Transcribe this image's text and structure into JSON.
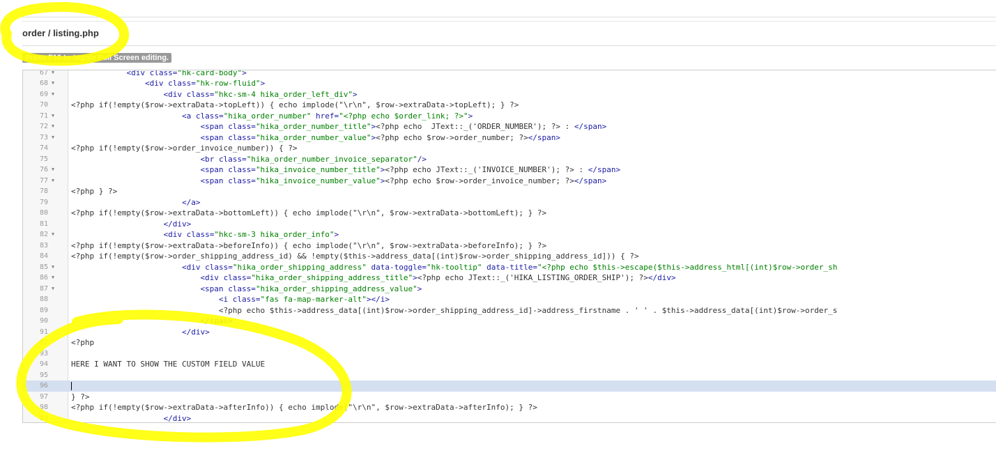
{
  "header": {
    "file_title": "order / listing.php",
    "fullscreen_hint": "Press F10 to toggle Full Screen editing."
  },
  "editor": {
    "active_line": 96,
    "lines": [
      {
        "n": "67",
        "fold": true,
        "parts": [
          {
            "t": "            "
          },
          {
            "c": "tag",
            "t": "<div "
          },
          {
            "c": "attr",
            "t": "class="
          },
          {
            "c": "str",
            "t": "\"hk-card-body\""
          },
          {
            "c": "tag",
            "t": ">"
          }
        ]
      },
      {
        "n": "68",
        "fold": true,
        "parts": [
          {
            "t": "                "
          },
          {
            "c": "tag",
            "t": "<div "
          },
          {
            "c": "attr",
            "t": "class="
          },
          {
            "c": "str",
            "t": "\"hk-row-fluid\""
          },
          {
            "c": "tag",
            "t": ">"
          }
        ]
      },
      {
        "n": "69",
        "fold": true,
        "parts": [
          {
            "t": "                    "
          },
          {
            "c": "tag",
            "t": "<div "
          },
          {
            "c": "attr",
            "t": "class="
          },
          {
            "c": "str",
            "t": "\"hkc-sm-4 hika_order_left_div\""
          },
          {
            "c": "tag",
            "t": ">"
          }
        ]
      },
      {
        "n": "70",
        "fold": false,
        "parts": [
          {
            "t": "<?php if(!empty($row->extraData->topLeft)) { echo implode(\"\\r\\n\", $row->extraData->topLeft); } ?>"
          }
        ]
      },
      {
        "n": "71",
        "fold": true,
        "parts": [
          {
            "t": "                        "
          },
          {
            "c": "tag",
            "t": "<a "
          },
          {
            "c": "attr",
            "t": "class="
          },
          {
            "c": "str",
            "t": "\"hika_order_number\""
          },
          {
            "c": "attr",
            "t": " href="
          },
          {
            "c": "str",
            "t": "\"<?php echo $order_link; ?>\""
          },
          {
            "c": "tag",
            "t": ">"
          }
        ]
      },
      {
        "n": "72",
        "fold": true,
        "parts": [
          {
            "t": "                            "
          },
          {
            "c": "tag",
            "t": "<span "
          },
          {
            "c": "attr",
            "t": "class="
          },
          {
            "c": "str",
            "t": "\"hika_order_number_title\""
          },
          {
            "c": "tag",
            "t": ">"
          },
          {
            "t": "<?php echo  JText::_('ORDER_NUMBER'); ?> : "
          },
          {
            "c": "tag",
            "t": "</span>"
          }
        ]
      },
      {
        "n": "73",
        "fold": true,
        "parts": [
          {
            "t": "                            "
          },
          {
            "c": "tag",
            "t": "<span "
          },
          {
            "c": "attr",
            "t": "class="
          },
          {
            "c": "str",
            "t": "\"hika_order_number_value\""
          },
          {
            "c": "tag",
            "t": ">"
          },
          {
            "t": "<?php echo $row->order_number; ?>"
          },
          {
            "c": "tag",
            "t": "</span>"
          }
        ]
      },
      {
        "n": "74",
        "fold": false,
        "parts": [
          {
            "t": "<?php if(!empty($row->order_invoice_number)) { ?>"
          }
        ]
      },
      {
        "n": "75",
        "fold": false,
        "parts": [
          {
            "t": "                            "
          },
          {
            "c": "tag",
            "t": "<br "
          },
          {
            "c": "attr",
            "t": "class="
          },
          {
            "c": "str",
            "t": "\"hika_order_number_invoice_separator\""
          },
          {
            "c": "tag",
            "t": "/>"
          }
        ]
      },
      {
        "n": "76",
        "fold": true,
        "parts": [
          {
            "t": "                            "
          },
          {
            "c": "tag",
            "t": "<span "
          },
          {
            "c": "attr",
            "t": "class="
          },
          {
            "c": "str",
            "t": "\"hika_invoice_number_title\""
          },
          {
            "c": "tag",
            "t": ">"
          },
          {
            "t": "<?php echo JText::_('INVOICE_NUMBER'); ?> : "
          },
          {
            "c": "tag",
            "t": "</span>"
          }
        ]
      },
      {
        "n": "77",
        "fold": true,
        "parts": [
          {
            "t": "                            "
          },
          {
            "c": "tag",
            "t": "<span "
          },
          {
            "c": "attr",
            "t": "class="
          },
          {
            "c": "str",
            "t": "\"hika_invoice_number_value\""
          },
          {
            "c": "tag",
            "t": ">"
          },
          {
            "t": "<?php echo $row->order_invoice_number; ?>"
          },
          {
            "c": "tag",
            "t": "</span>"
          }
        ]
      },
      {
        "n": "78",
        "fold": false,
        "parts": [
          {
            "t": "<?php } ?>"
          }
        ]
      },
      {
        "n": "79",
        "fold": false,
        "parts": [
          {
            "t": "                        "
          },
          {
            "c": "tag",
            "t": "</a>"
          }
        ]
      },
      {
        "n": "80",
        "fold": false,
        "parts": [
          {
            "t": "<?php if(!empty($row->extraData->bottomLeft)) { echo implode(\"\\r\\n\", $row->extraData->bottomLeft); } ?>"
          }
        ]
      },
      {
        "n": "81",
        "fold": false,
        "parts": [
          {
            "t": "                    "
          },
          {
            "c": "tag",
            "t": "</div>"
          }
        ]
      },
      {
        "n": "82",
        "fold": true,
        "parts": [
          {
            "t": "                    "
          },
          {
            "c": "tag",
            "t": "<div "
          },
          {
            "c": "attr",
            "t": "class="
          },
          {
            "c": "str",
            "t": "\"hkc-sm-3 hika_order_info\""
          },
          {
            "c": "tag",
            "t": ">"
          }
        ]
      },
      {
        "n": "83",
        "fold": false,
        "parts": [
          {
            "t": "<?php if(!empty($row->extraData->beforeInfo)) { echo implode(\"\\r\\n\", $row->extraData->beforeInfo); } ?>"
          }
        ]
      },
      {
        "n": "84",
        "fold": false,
        "parts": [
          {
            "t": "<?php if(!empty($row->order_shipping_address_id) && !empty($this->address_data[(int)$row->order_shipping_address_id])) { ?>"
          }
        ]
      },
      {
        "n": "85",
        "fold": true,
        "parts": [
          {
            "t": "                        "
          },
          {
            "c": "tag",
            "t": "<div "
          },
          {
            "c": "attr",
            "t": "class="
          },
          {
            "c": "str",
            "t": "\"hika_order_shipping_address\""
          },
          {
            "c": "attr",
            "t": " data-toggle="
          },
          {
            "c": "str",
            "t": "\"hk-tooltip\""
          },
          {
            "c": "attr",
            "t": " data-title="
          },
          {
            "c": "str",
            "t": "\"<?php echo $this->escape($this->address_html[(int)$row->order_sh"
          }
        ]
      },
      {
        "n": "86",
        "fold": true,
        "parts": [
          {
            "t": "                            "
          },
          {
            "c": "tag",
            "t": "<div "
          },
          {
            "c": "attr",
            "t": "class="
          },
          {
            "c": "str",
            "t": "\"hika_order_shipping_address_title\""
          },
          {
            "c": "tag",
            "t": ">"
          },
          {
            "t": "<?php echo JText::_('HIKA_LISTING_ORDER_SHIP'); ?>"
          },
          {
            "c": "tag",
            "t": "</div>"
          }
        ]
      },
      {
        "n": "87",
        "fold": true,
        "parts": [
          {
            "t": "                            "
          },
          {
            "c": "tag",
            "t": "<span "
          },
          {
            "c": "attr",
            "t": "class="
          },
          {
            "c": "str",
            "t": "\"hika_order_shipping_address_value\""
          },
          {
            "c": "tag",
            "t": ">"
          }
        ]
      },
      {
        "n": "88",
        "fold": false,
        "parts": [
          {
            "t": "                                "
          },
          {
            "c": "tag",
            "t": "<i "
          },
          {
            "c": "attr",
            "t": "class="
          },
          {
            "c": "str",
            "t": "\"fas fa-map-marker-alt\""
          },
          {
            "c": "tag",
            "t": "></i>"
          }
        ]
      },
      {
        "n": "89",
        "fold": false,
        "parts": [
          {
            "t": "                                <?php echo $this->address_data[(int)$row->order_shipping_address_id]->address_firstname . ' ' . $this->address_data[(int)$row->order_s"
          }
        ]
      },
      {
        "n": "90",
        "fold": false,
        "parts": [
          {
            "t": "                            "
          },
          {
            "c": "tag",
            "t": "</span>"
          }
        ]
      },
      {
        "n": "91",
        "fold": false,
        "parts": [
          {
            "t": "                        "
          },
          {
            "c": "tag",
            "t": "</div>"
          }
        ]
      },
      {
        "n": "92",
        "fold": false,
        "parts": [
          {
            "t": "<?php"
          }
        ]
      },
      {
        "n": "93",
        "fold": false,
        "parts": [
          {
            "t": ""
          }
        ]
      },
      {
        "n": "94",
        "fold": false,
        "parts": [
          {
            "t": "HERE I WANT TO SHOW THE CUSTOM FIELD VALUE"
          }
        ]
      },
      {
        "n": "95",
        "fold": false,
        "parts": [
          {
            "t": ""
          }
        ]
      },
      {
        "n": "96",
        "fold": false,
        "parts": [
          {
            "t": ""
          }
        ]
      },
      {
        "n": "97",
        "fold": false,
        "parts": [
          {
            "t": "} ?>"
          }
        ]
      },
      {
        "n": "98",
        "fold": false,
        "parts": [
          {
            "t": "<?php if(!empty($row->extraData->afterInfo)) { echo implode(\"\\r\\n\", $row->extraData->afterInfo); } ?>"
          }
        ]
      },
      {
        "n": "99",
        "fold": false,
        "parts": [
          {
            "t": "                    "
          },
          {
            "c": "tag",
            "t": "</div>"
          }
        ]
      }
    ]
  },
  "annotations": {
    "highlight_color": "#ffff00"
  }
}
